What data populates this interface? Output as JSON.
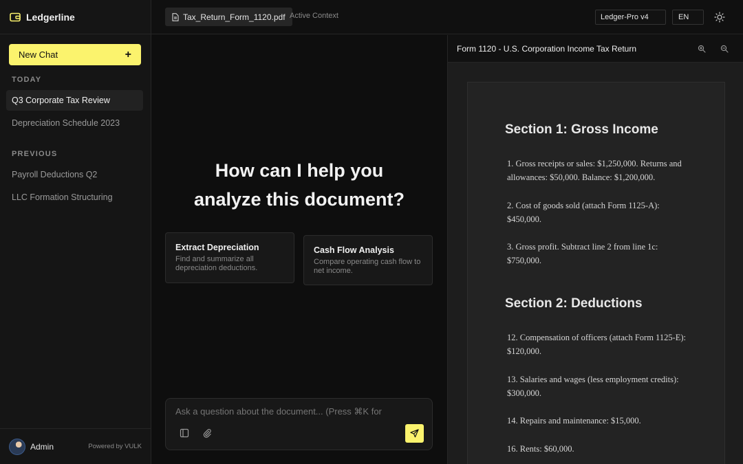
{
  "app": {
    "name": "Ledgerline",
    "accent": "#fbf36d"
  },
  "sidebar": {
    "new_chat_label": "New Chat",
    "new_chat_icon": "plus-icon",
    "today_label": "TODAY",
    "today_items": [
      {
        "label": "Q3 Corporate Tax Review",
        "active": true
      },
      {
        "label": "Depreciation Schedule 2023",
        "active": false
      }
    ],
    "previous_label": "PREVIOUS",
    "previous_items": [
      {
        "label": "Payroll Deductions Q2"
      },
      {
        "label": "LLC Formation Structuring"
      }
    ],
    "user_name": "Admin",
    "powered_by": "Powered by VULK"
  },
  "topbar": {
    "file_name": "Tax_Return_Form_1120.pdf",
    "context_label": "Active Context",
    "model": "Ledger-Pro v4",
    "language": "EN",
    "theme_icon": "sun-icon"
  },
  "chat": {
    "hero_line1": "How can I help you",
    "hero_line2": "analyze this document?",
    "suggestions": [
      {
        "title": "Extract Depreciation",
        "desc": "Find and summarize all depreciation deductions."
      },
      {
        "title": "Cash Flow Analysis",
        "desc": "Compare operating cash flow to net income."
      }
    ],
    "input_placeholder": "Ask a question about the document... (Press ⌘K for"
  },
  "document": {
    "title": "Form 1120 - U.S. Corporation Income Tax Return",
    "section1_heading": "Section 1: Gross Income",
    "section1_lines": [
      "1. Gross receipts or sales: $1,250,000. Returns and allowances: $50,000. Balance: $1,200,000.",
      "2. Cost of goods sold (attach Form 1125-A): $450,000.",
      "3. Gross profit. Subtract line 2 from line 1c: $750,000."
    ],
    "section2_heading": "Section 2: Deductions",
    "section2_lines": [
      "12. Compensation of officers (attach Form 1125-E): $120,000.",
      "13. Salaries and wages (less employment credits): $300,000.",
      "14. Repairs and maintenance: $15,000.",
      "16. Rents: $60,000."
    ]
  }
}
